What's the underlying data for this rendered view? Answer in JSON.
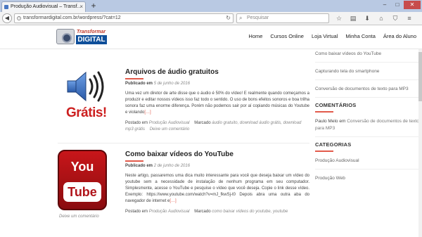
{
  "browser": {
    "tab_title": "Produção Audiovisual – Transf...",
    "tab_close": "×",
    "new_tab": "+",
    "url": "transformardigital.com.br/wordpress/?cat=12",
    "search_placeholder": "Pesquisar"
  },
  "site": {
    "logo_top": "Transformar",
    "logo_main": "DIGITAL",
    "nav": [
      "Home",
      "Cursos Online",
      "Loja Virtual",
      "Minha Conta",
      "Área do Aluno"
    ]
  },
  "articles": [
    {
      "title": "Arquivos de áudio gratuitos",
      "published_label": "Publicado em",
      "date": "5 de junho de 2016",
      "excerpt_plain": "Uma vez um diretor de arte disse que o áudio é 50% do vídeo! E realmente quando começamos a produzir e editar nossos vídeos isso faz todo o sentido. O uso de bons efeitos sonoros e boa trilha sonora faz uma enorme diferença. Porém não podemos sair por aí copiando músicas do Youtube e violando",
      "more": "[…]",
      "posted_in_label": "Postado em",
      "category": "Produção Audiovisual",
      "tagged_label": "Marcado",
      "tags": "áudio gratuito, download áudio grátis, download mp3 grátis",
      "comment": "Deixe um comentário",
      "thumb_text": "Grátis!"
    },
    {
      "title": "Como baixar vídeos do YouTube",
      "published_label": "Publicado em",
      "date": "2 de junho de 2016",
      "excerpt_plain": "Neste artigo, passaremos uma dica muito interessante para você que deseja baixar um vídeo do youtube sem a necessidade de instalação de nenhum programa em seu computador. Simplesmente, acesse o YouTube e pesquise o vídeo que você deseja. Copie o link desse vídeo. Exemplo: https://www.youtube.com/watch?v=mJ_fkwSj-t0 Depois abra uma outra aba do navegador de internet e",
      "more": "[…]",
      "posted_in_label": "Postado em",
      "category": "Produção Audiovisual",
      "tagged_label": "Marcado",
      "tags": "como baixar vídeos do youtube, youtube",
      "comment": "Deixe um comentário",
      "thumb_you": "You",
      "thumb_tube": "Tube"
    }
  ],
  "sidebar": {
    "recent_posts": [
      "Como baixar vídeos do YouTube",
      "Capturando tela do smartphone",
      "Conversão de documentos de texto para MP3"
    ],
    "comments_heading": "COMENTÁRIOS",
    "comment_author": "Paulo Melo",
    "comment_on": "em",
    "comment_post": "Conversão de documentos de texto para MP3",
    "categories_heading": "CATEGORIAS",
    "categories": [
      "Produção Audiovisual",
      "Produção Web"
    ]
  },
  "colors": {
    "accent": "#e25a4b",
    "logo_blue": "#0f4f9a"
  }
}
